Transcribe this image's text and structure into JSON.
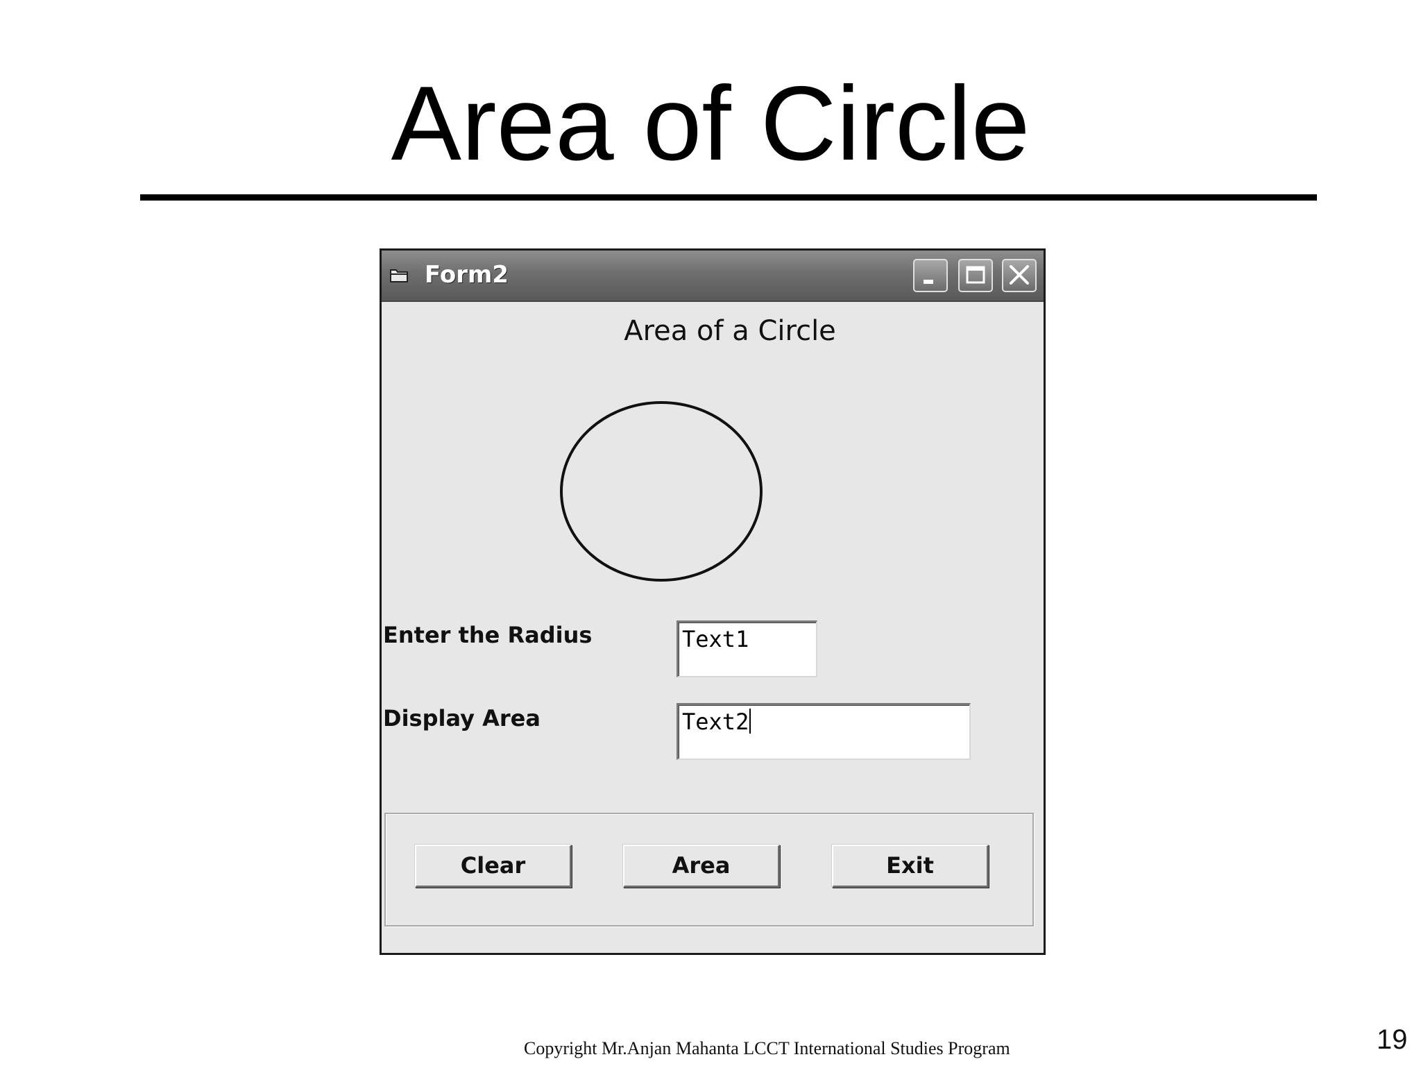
{
  "slide": {
    "title": "Area of Circle",
    "footer": "Copyright Mr.Anjan Mahanta LCCT International Studies Program",
    "page_number": "19"
  },
  "window": {
    "title": "Form2",
    "icon": "form-icon",
    "controls": [
      "minimize-icon",
      "maximize-icon",
      "close-icon"
    ]
  },
  "form": {
    "heading": "Area of a Circle",
    "shape": "circle",
    "radius_label": "Enter the Radius",
    "radius_value": "Text1",
    "area_label": "Display Area",
    "area_value": "Text2"
  },
  "buttons": {
    "clear": "Clear",
    "area": "Area",
    "exit": "Exit"
  },
  "colors": {
    "titlebar": "#6e6e6e",
    "form_background": "#e7e7e7"
  }
}
